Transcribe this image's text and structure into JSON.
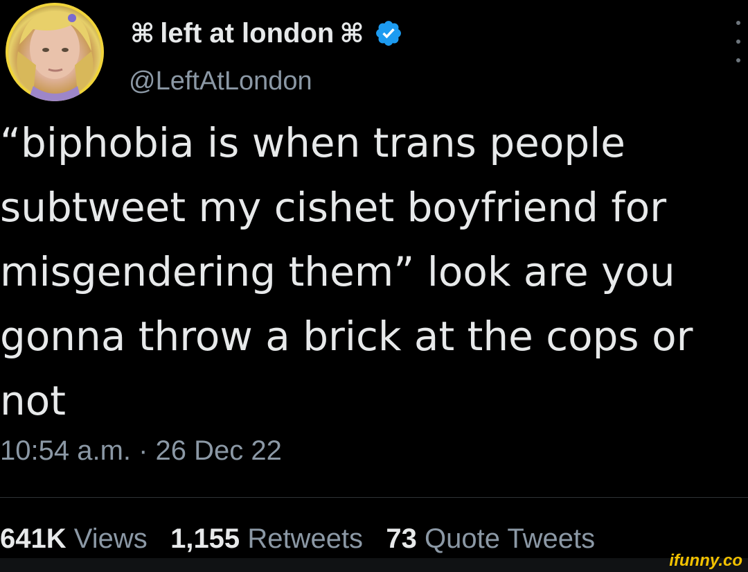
{
  "tweet": {
    "author": {
      "cmd_symbol": "⌘",
      "display_name": "left at london",
      "handle": "@LeftAtLondon",
      "verified_icon": "verified-badge-icon"
    },
    "text": "“biphobia is when trans people\nsubtweet my cishet boyfriend for\nmisgendering them” look are you\ngonna throw a brick at the cops or\nnot",
    "timestamp": "10:54 a.m. · 26 Dec 22",
    "stats": {
      "views_count": "641K",
      "views_label": "Views",
      "retweets_count": "1,155",
      "retweets_label": "Retweets",
      "quotes_count": "73",
      "quotes_label": "Quote Tweets"
    }
  },
  "watermark": "ifunny.co",
  "colors": {
    "background": "#000000",
    "text_primary": "#e7e9ea",
    "text_secondary": "#8b98a5",
    "verified_blue": "#1d9bf0",
    "watermark": "#f2c200"
  }
}
